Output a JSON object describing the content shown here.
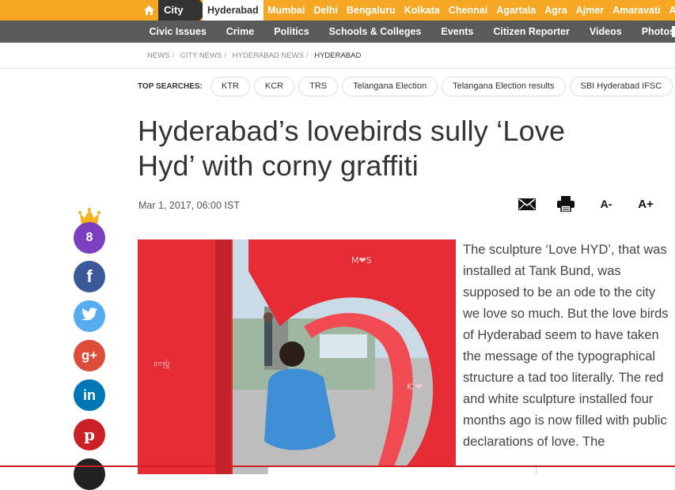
{
  "topnav": {
    "city_label": "City",
    "cities": [
      "Hyderabad",
      "Mumbai",
      "Delhi",
      "Bengaluru",
      "Kolkata",
      "Chennai",
      "Agartala",
      "Agra",
      "Ajmer",
      "Amaravati",
      "Ahm"
    ],
    "active_city_index": 0
  },
  "subnav": {
    "items": [
      "Civic Issues",
      "Crime",
      "Politics",
      "Schools & Colleges",
      "Events",
      "Citizen Reporter",
      "Videos",
      "Photos"
    ]
  },
  "breadcrumb": [
    "NEWS",
    "CITY NEWS",
    "HYDERABAD NEWS",
    "HYDERABAD"
  ],
  "top_searches": {
    "label": "TOP SEARCHES:",
    "items": [
      "KTR",
      "KCR",
      "TRS",
      "Telangana Election",
      "Telangana Election results",
      "SBI Hyderabad IFSC"
    ]
  },
  "article": {
    "title": "Hyderabad’s lovebirds sully ‘Love Hyd’ with corny graffiti",
    "date": "Mar 1, 2017, 06:00 IST",
    "body": "The sculpture ‘Love HYD’, that was installed at Tank Bund, was supposed to be an ode to the city we love so much. But the love birds of Hyderabad seem to have taken the message of the typographical structure a tad too literally. The red and white sculpture installed four months ago is now filled with public declarations of love. The"
  },
  "tools": {
    "font_decrease": "A-",
    "font_increase": "A+"
  },
  "share": {
    "count": "8"
  },
  "colors": {
    "brand": "#f5a623",
    "subnav_bg": "#5a5a5a",
    "facebook": "#3b5998",
    "twitter": "#55acee",
    "googleplus": "#dd4b39",
    "linkedin": "#0077b5",
    "pinterest": "#cb2027",
    "counter": "#7b3fbf"
  }
}
